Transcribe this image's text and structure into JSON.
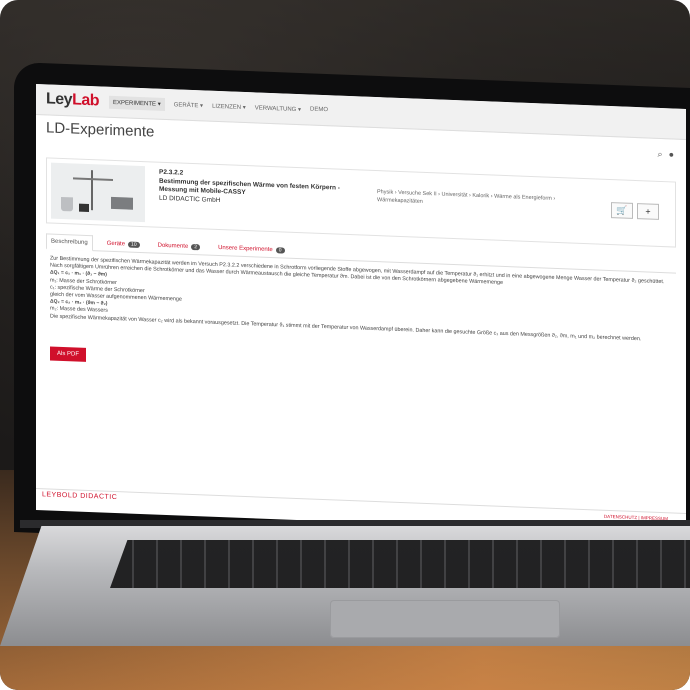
{
  "app": {
    "logo_prefix": "Ley",
    "logo_suffix": "Lab"
  },
  "nav": [
    "EXPERIMENTE ▾",
    "GERÄTE ▾",
    "LIZENZEN ▾",
    "VERWALTUNG ▾",
    "Demo"
  ],
  "page": {
    "title": "LD-Experimente"
  },
  "experiment": {
    "number": "P2.3.2.2",
    "title": "Bestimmung der spezifischen Wärme von festen Körpern - Messung mit Mobile-CASSY",
    "company": "LD DIDACTIC GmbH",
    "category": "Physik › Versuche Sek II › Universität › Kalorik › Wärme als Energieform › Wärmekapazitäten",
    "cart_icon": "🛒",
    "add_label": "+"
  },
  "tabs": [
    {
      "label": "Beschreibung",
      "badge": ""
    },
    {
      "label": "Geräte",
      "badge": "10"
    },
    {
      "label": "Dokumente",
      "badge": "2"
    },
    {
      "label": "Unsere Experimente",
      "badge": "0"
    }
  ],
  "description": {
    "p1": "Zur Bestimmung der spezifischen Wärmekapazität werden im Versuch P2.3.2.2 verschiedene in Schrotform vorliegende Stoffe abgewogen, mit Wasserdampf auf die Temperatur ϑ₁ erhitzt und in eine abgewogene Menge Wasser der Temperatur ϑ₂ geschüttet. Nach sorgfältigem Umrühren erreichen die Schrotkörner und das Wasser durch Wärmeaustausch die gleiche Temperatur ϑm. Dabei ist die von den Schrotkörnern abgegebene Wärmemenge",
    "eq1": "ΔQ₁ = c₁ · m₁ · (ϑ₁ − ϑm)",
    "l1": "m₁: Masse der Schrotkörner",
    "l2": "c₁: spezifische Wärme der Schrotkörner",
    "p2": "gleich der vom Wasser aufgenommenen Wärmemenge",
    "eq2": "ΔQ₂ = c₂ · m₂ · (ϑm − ϑ₂)",
    "l3": "m₂: Masse des Wassers",
    "p3": "Die spezifische Wärmekapazität von Wasser c₂ wird als bekannt vorausgesetzt. Die Temperatur ϑ₁ stimmt mit der Temperatur von Wasserdampf überein. Daher kann die gesuchte Größe c₁ aus den Messgrößen ϑ₂, ϑm, m₁ und m₂ berechnet werden."
  },
  "pdf_button": "Als PDF",
  "footer": {
    "brand": "LEYBOLD DIDACTIC",
    "legal": "DATENSCHUTZ | IMPRESSUM"
  },
  "colors": {
    "accent": "#d0102b"
  }
}
